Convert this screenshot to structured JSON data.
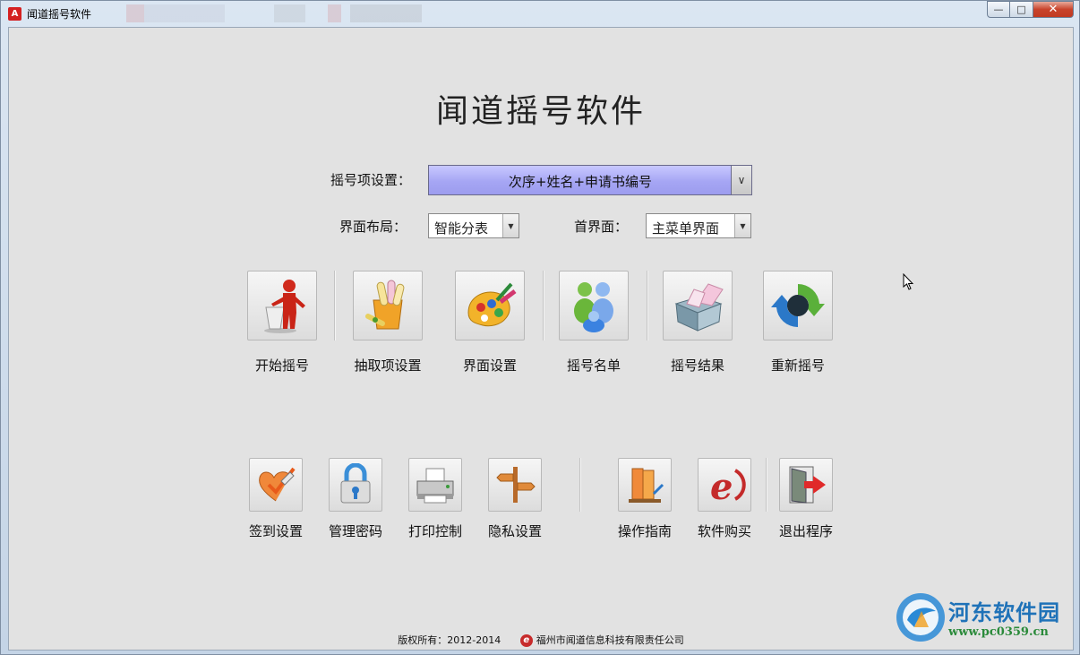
{
  "window": {
    "title": "闻道摇号软件"
  },
  "app": {
    "title": "闻道摇号软件",
    "lottery_item_label": "摇号项设置：",
    "lottery_item_value": "次序+姓名+申请书编号",
    "layout_label": "界面布局：",
    "layout_value": "智能分表",
    "home_label": "首界面：",
    "home_value": "主菜单界面"
  },
  "main_actions": [
    {
      "label": "开始摇号",
      "icon": "speaker-podium-icon"
    },
    {
      "label": "抽取项设置",
      "icon": "scrolls-icon"
    },
    {
      "label": "界面设置",
      "icon": "palette-icon"
    },
    {
      "label": "摇号名单",
      "icon": "users-icon"
    },
    {
      "label": "摇号结果",
      "icon": "box-icon"
    },
    {
      "label": "重新摇号",
      "icon": "refresh-icon"
    }
  ],
  "secondary_actions": [
    {
      "label": "签到设置",
      "icon": "heart-check-icon"
    },
    {
      "label": "管理密码",
      "icon": "lock-icon"
    },
    {
      "label": "打印控制",
      "icon": "printer-icon"
    },
    {
      "label": "隐私设置",
      "icon": "signpost-icon"
    },
    {
      "label": "操作指南",
      "icon": "books-icon"
    },
    {
      "label": "软件购买",
      "icon": "e-logo-icon"
    },
    {
      "label": "退出程序",
      "icon": "exit-icon"
    }
  ],
  "footer": {
    "copyright": "版权所有：2012-2014",
    "company": "福州市闻道信息科技有限责任公司"
  },
  "watermark": {
    "name": "河东软件园",
    "url": "www.pc0359.cn"
  }
}
